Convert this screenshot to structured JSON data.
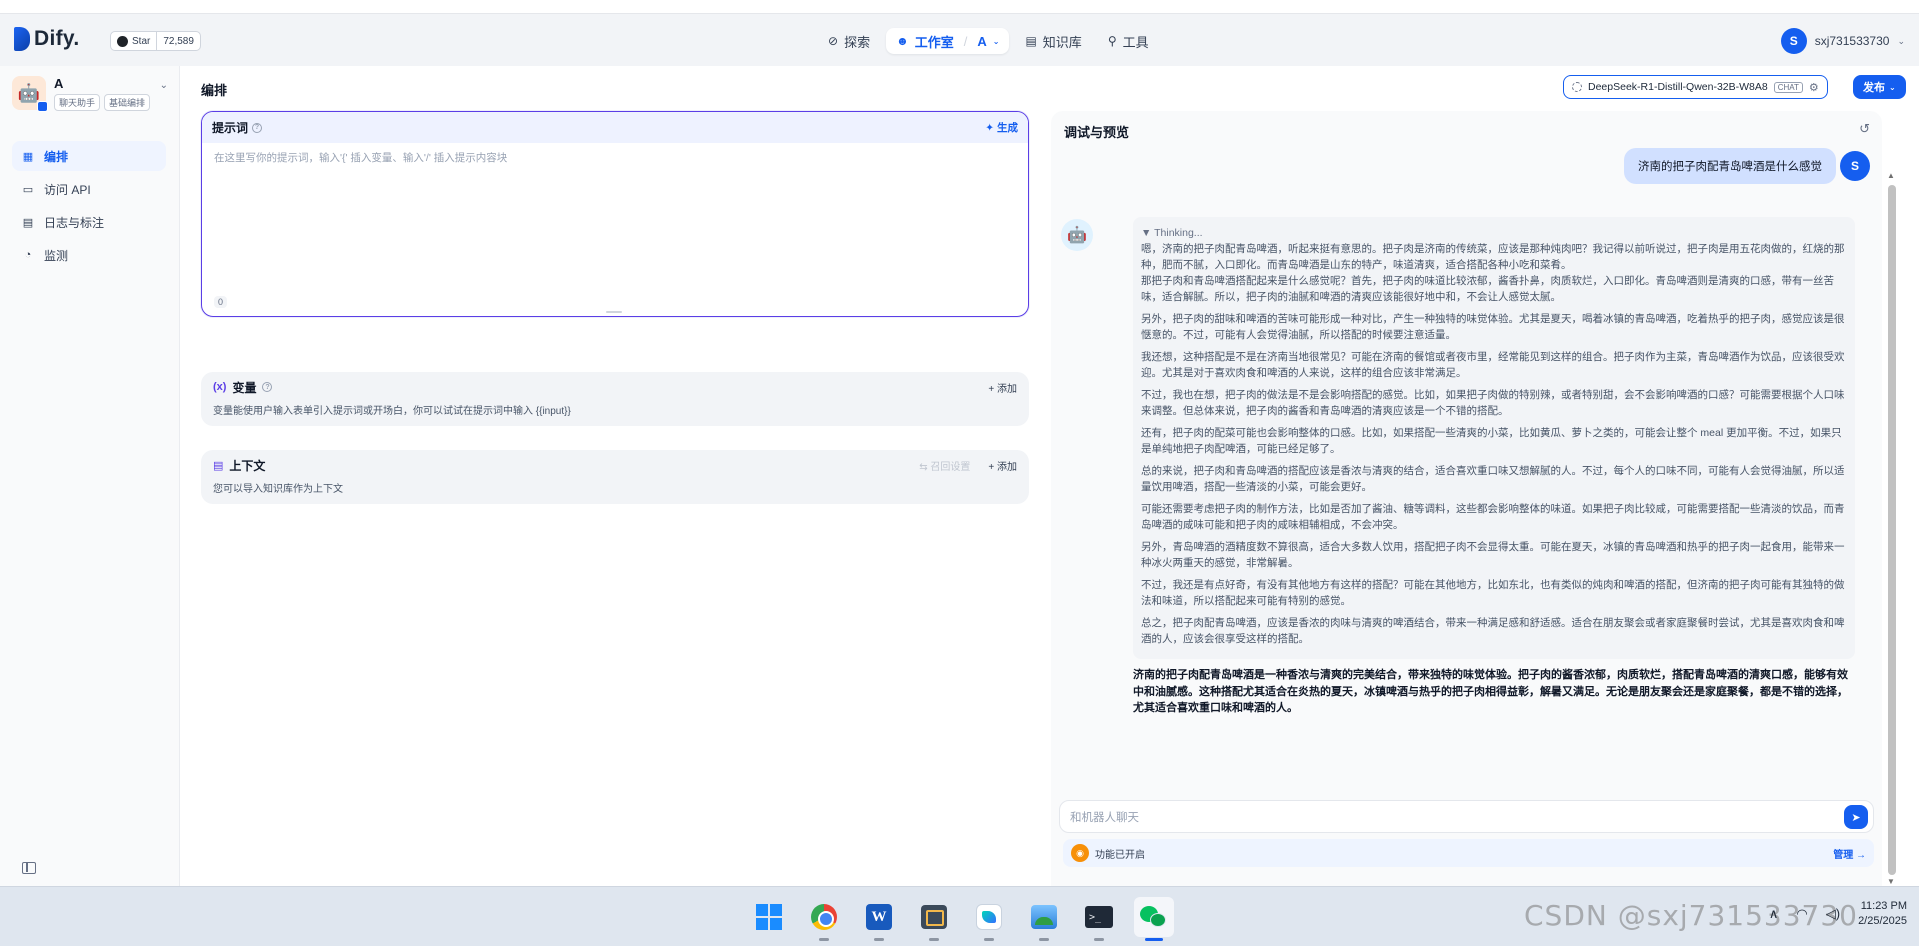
{
  "header": {
    "brand": "Dify.",
    "github": {
      "star_label": "Star",
      "star_count": "72,589"
    },
    "nav": [
      {
        "label": "探索",
        "icon": "compass-icon"
      },
      {
        "label": "工作室",
        "icon": "robot-icon",
        "active": true,
        "workspace": "A"
      },
      {
        "label": "知识库",
        "icon": "book-icon"
      },
      {
        "label": "工具",
        "icon": "tool-icon"
      }
    ],
    "user": {
      "initial": "S",
      "name": "sxj731533730"
    }
  },
  "sidebar": {
    "app_name": "A",
    "tags": [
      "聊天助手",
      "基础编排"
    ],
    "items": [
      {
        "label": "编排",
        "icon": "layout-icon",
        "active": true
      },
      {
        "label": "访问 API",
        "icon": "terminal-icon"
      },
      {
        "label": "日志与标注",
        "icon": "log-icon"
      },
      {
        "label": "监测",
        "icon": "monitor-icon"
      }
    ]
  },
  "main": {
    "title": "编排",
    "model": {
      "name": "DeepSeek-R1-Distill-Qwen-32B-W8A8",
      "mode": "CHAT"
    },
    "publish_label": "发布",
    "prompt": {
      "title": "提示词",
      "generate_label": "生成",
      "placeholder": "在这里写你的提示词，输入'{' 插入变量、输入'/' 插入提示内容块",
      "char_count": "0"
    },
    "variables": {
      "title": "变量",
      "add_label": "添加",
      "description": "变量能使用户输入表单引入提示词或开场白，你可以试试在提示词中输入 {{input}}"
    },
    "context": {
      "title": "上下文",
      "recall_label": "召回设置",
      "add_label": "添加",
      "description": "您可以导入知识库作为上下文"
    }
  },
  "debug": {
    "title": "调试与预览",
    "user_message": "济南的把子肉配青岛啤酒是什么感觉",
    "user_initial": "S",
    "thinking_label": "▼ Thinking...",
    "thinking_paragraphs": [
      "嗯，济南的把子肉配青岛啤酒，听起来挺有意思的。把子肉是济南的传统菜，应该是那种炖肉吧？我记得以前听说过，把子肉是用五花肉做的，红烧的那种，肥而不腻，入口即化。而青岛啤酒是山东的特产，味道清爽，适合搭配各种小吃和菜肴。",
      "那把子肉和青岛啤酒搭配起来是什么感觉呢？首先，把子肉的味道比较浓郁，酱香扑鼻，肉质软烂，入口即化。青岛啤酒则是清爽的口感，带有一丝苦味，适合解腻。所以，把子肉的油腻和啤酒的清爽应该能很好地中和，不会让人感觉太腻。",
      "另外，把子肉的甜味和啤酒的苦味可能形成一种对比，产生一种独特的味觉体验。尤其是夏天，喝着冰镇的青岛啤酒，吃着热乎的把子肉，感觉应该是很惬意的。不过，可能有人会觉得油腻，所以搭配的时候要注意适量。",
      "我还想，这种搭配是不是在济南当地很常见？可能在济南的餐馆或者夜市里，经常能见到这样的组合。把子肉作为主菜，青岛啤酒作为饮品，应该很受欢迎。尤其是对于喜欢肉食和啤酒的人来说，这样的组合应该非常满足。",
      "不过，我也在想，把子肉的做法是不是会影响搭配的感觉。比如，如果把子肉做的特别辣，或者特别甜，会不会影响啤酒的口感？可能需要根据个人口味来调整。但总体来说，把子肉的酱香和青岛啤酒的清爽应该是一个不错的搭配。",
      "还有，把子肉的配菜可能也会影响整体的口感。比如，如果搭配一些清爽的小菜，比如黄瓜、萝卜之类的，可能会让整个 meal 更加平衡。不过，如果只是单纯地把子肉配啤酒，可能已经足够了。",
      "总的来说，把子肉和青岛啤酒的搭配应该是香浓与清爽的结合，适合喜欢重口味又想解腻的人。不过，每个人的口味不同，可能有人会觉得油腻，所以适量饮用啤酒，搭配一些清淡的小菜，可能会更好。",
      "可能还需要考虑把子肉的制作方法，比如是否加了酱油、糖等调料，这些都会影响整体的味道。如果把子肉比较咸，可能需要搭配一些清淡的饮品，而青岛啤酒的咸味可能和把子肉的咸味相辅相成，不会冲突。",
      "另外，青岛啤酒的酒精度数不算很高，适合大多数人饮用，搭配把子肉不会显得太重。可能在夏天，冰镇的青岛啤酒和热乎的把子肉一起食用，能带来一种冰火两重天的感觉，非常解暑。",
      "不过，我还是有点好奇，有没有其他地方有这样的搭配？可能在其他地方，比如东北，也有类似的炖肉和啤酒的搭配，但济南的把子肉可能有其独特的做法和味道，所以搭配起来可能有特别的感觉。",
      "总之，把子肉配青岛啤酒，应该是香浓的肉味与清爽的啤酒结合，带来一种满足感和舒适感。适合在朋友聚会或者家庭聚餐时尝试，尤其是喜欢肉食和啤酒的人，应该会很享受这样的搭配。"
    ],
    "final_answer": "济南的把子肉配青岛啤酒是一种香浓与清爽的完美结合，带来独特的味觉体验。把子肉的酱香浓郁，肉质软烂，搭配青岛啤酒的清爽口感，能够有效中和油腻感。这种搭配尤其适合在炎热的夏天，冰镇啤酒与热乎的把子肉相得益彰，解暑又满足。无论是朋友聚会还是家庭聚餐，都是不错的选择，尤其适合喜欢重口味和啤酒的人。",
    "input_placeholder": "和机器人聊天",
    "feature_text": "功能已开启",
    "manage_label": "管理"
  },
  "taskbar": {
    "apps": [
      "windows-start",
      "chrome",
      "word",
      "snipping-tool",
      "feishu",
      "photos",
      "terminal",
      "wechat"
    ],
    "time": "11:23 PM",
    "date": "2/25/2025",
    "watermark": "CSDN @sxj731533730"
  }
}
